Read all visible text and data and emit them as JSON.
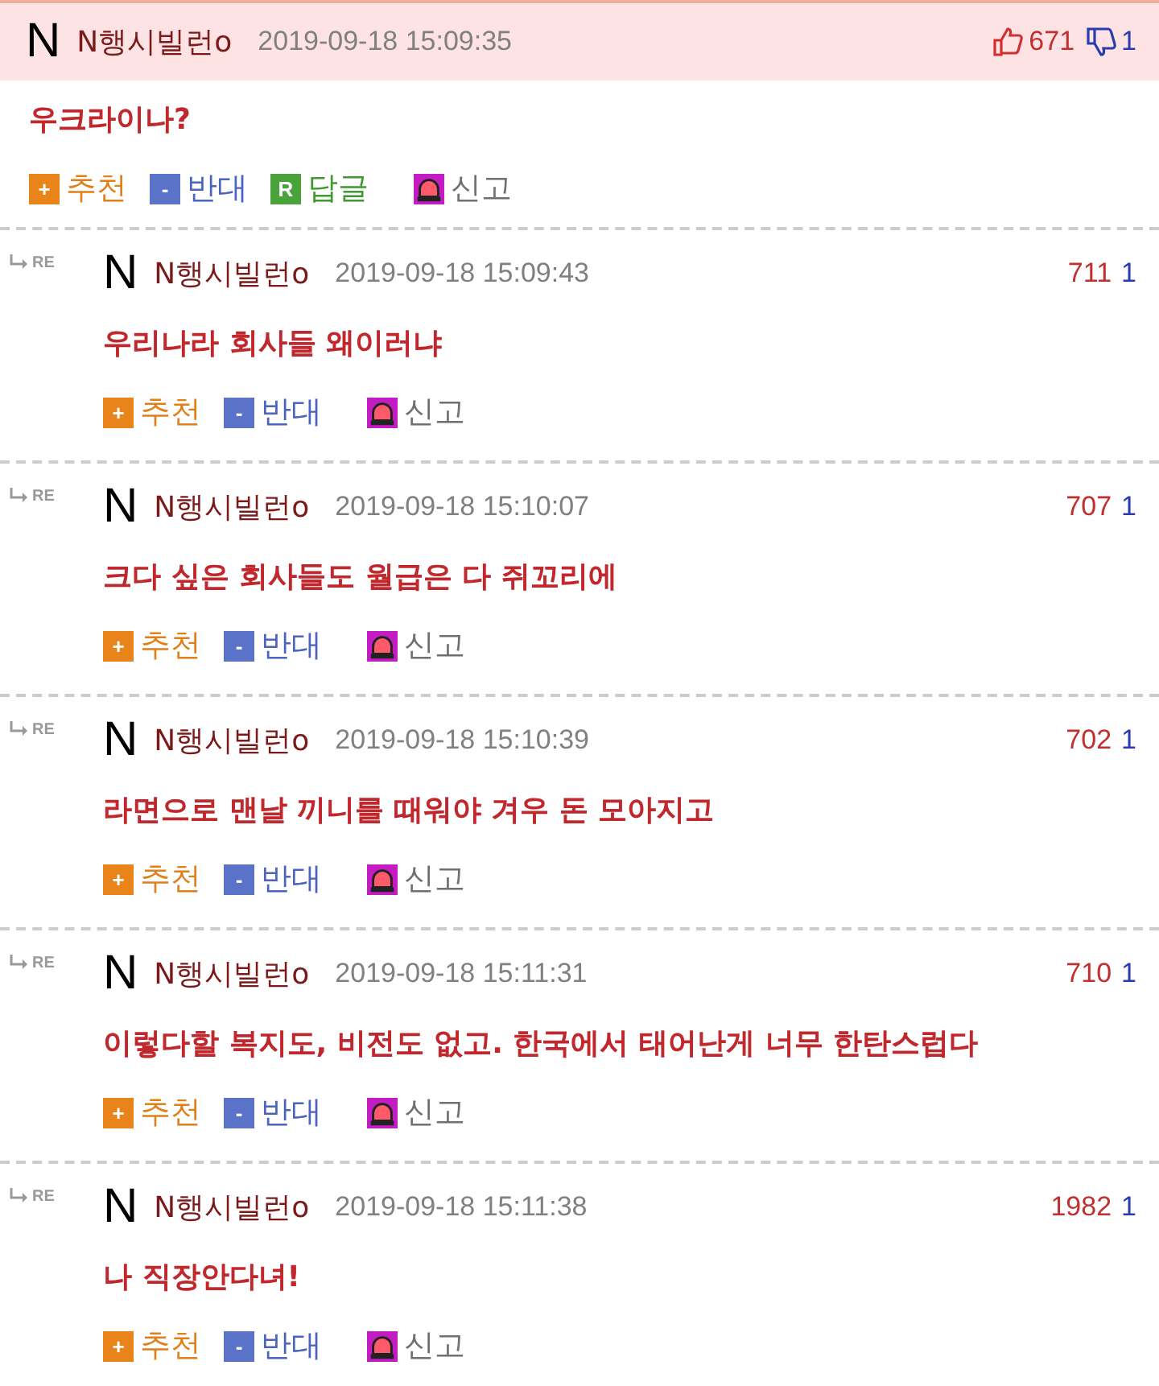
{
  "post": {
    "logo": "N",
    "author": "N행시빌런o",
    "date": "2019-09-18 15:09:35",
    "likes": "671",
    "dislikes": "1",
    "text": "우크라이나?",
    "actions": [
      {
        "kind": "up",
        "icon": "+",
        "label": "추천"
      },
      {
        "kind": "down",
        "icon": "-",
        "label": "반대"
      },
      {
        "kind": "reply",
        "icon": "R",
        "label": "답글"
      },
      {
        "kind": "report",
        "label": "신고"
      }
    ]
  },
  "replies": [
    {
      "marker": "RE",
      "logo": "N",
      "author": "N행시빌런o",
      "date": "2019-09-18 15:09:43",
      "likes": "711",
      "dislikes": "1",
      "text": "우리나라 회사들 왜이러냐",
      "actions": [
        {
          "kind": "up",
          "icon": "+",
          "label": "추천"
        },
        {
          "kind": "down",
          "icon": "-",
          "label": "반대"
        },
        {
          "kind": "report",
          "label": "신고"
        }
      ]
    },
    {
      "marker": "RE",
      "logo": "N",
      "author": "N행시빌런o",
      "date": "2019-09-18 15:10:07",
      "likes": "707",
      "dislikes": "1",
      "text": "크다 싶은 회사들도 월급은 다 쥐꼬리에",
      "actions": [
        {
          "kind": "up",
          "icon": "+",
          "label": "추천"
        },
        {
          "kind": "down",
          "icon": "-",
          "label": "반대"
        },
        {
          "kind": "report",
          "label": "신고"
        }
      ]
    },
    {
      "marker": "RE",
      "logo": "N",
      "author": "N행시빌런o",
      "date": "2019-09-18 15:10:39",
      "likes": "702",
      "dislikes": "1",
      "text": "라면으로 맨날 끼니를 때워야 겨우 돈 모아지고",
      "actions": [
        {
          "kind": "up",
          "icon": "+",
          "label": "추천"
        },
        {
          "kind": "down",
          "icon": "-",
          "label": "반대"
        },
        {
          "kind": "report",
          "label": "신고"
        }
      ]
    },
    {
      "marker": "RE",
      "logo": "N",
      "author": "N행시빌런o",
      "date": "2019-09-18 15:11:31",
      "likes": "710",
      "dislikes": "1",
      "text": "이렇다할 복지도, 비전도 없고. 한국에서 태어난게 너무 한탄스럽다",
      "actions": [
        {
          "kind": "up",
          "icon": "+",
          "label": "추천"
        },
        {
          "kind": "down",
          "icon": "-",
          "label": "반대"
        },
        {
          "kind": "report",
          "label": "신고"
        }
      ]
    },
    {
      "marker": "RE",
      "logo": "N",
      "author": "N행시빌런o",
      "date": "2019-09-18 15:11:38",
      "likes": "1982",
      "dislikes": "1",
      "text": "나 직장안다녀!",
      "actions": [
        {
          "kind": "up",
          "icon": "+",
          "label": "추천"
        },
        {
          "kind": "down",
          "icon": "-",
          "label": "반대"
        },
        {
          "kind": "report",
          "label": "신고"
        }
      ]
    }
  ]
}
